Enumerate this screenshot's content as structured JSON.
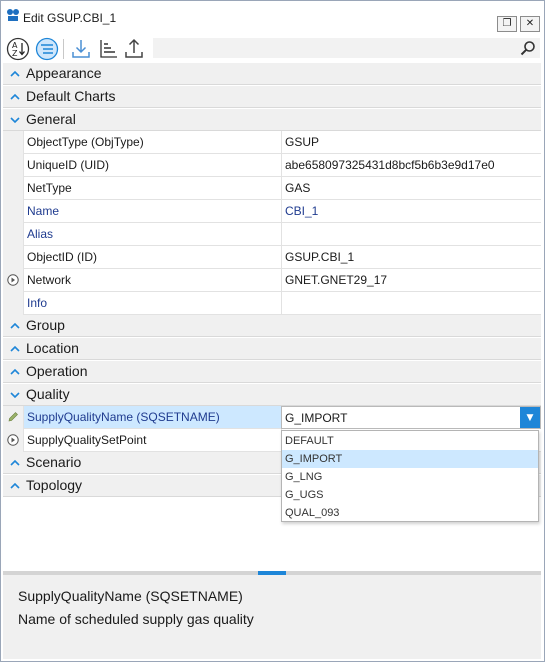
{
  "window": {
    "title": "Edit GSUP.CBI_1",
    "maximize_glyph": "❐",
    "close_glyph": "✕"
  },
  "toolbar": {
    "buttons": [
      {
        "icon": "sort-alphabetical-icon"
      },
      {
        "icon": "categorized-view-icon",
        "active": true
      },
      {
        "icon": "import-icon"
      },
      {
        "icon": "sort-list-icon"
      },
      {
        "icon": "export-icon"
      }
    ],
    "search": {
      "value": "",
      "placeholder": ""
    }
  },
  "categories": {
    "appearance": "Appearance",
    "default_charts": "Default Charts",
    "general": "General",
    "group": "Group",
    "location": "Location",
    "operation": "Operation",
    "quality": "Quality",
    "scenario": "Scenario",
    "topology": "Topology"
  },
  "general_props": [
    {
      "name": "ObjectType (ObjType)",
      "value": "GSUP"
    },
    {
      "name": "UniqueID (UID)",
      "value": "abe658097325431d8bcf5b6b3e9d17e0"
    },
    {
      "name": "NetType",
      "value": "GAS"
    },
    {
      "name": "Name",
      "value": "CBI_1"
    },
    {
      "name": "Alias",
      "value": ""
    },
    {
      "name": "ObjectID (ID)",
      "value": "GSUP.CBI_1"
    },
    {
      "name": "Network",
      "value": "GNET.GNET29_17"
    },
    {
      "name": "Info",
      "value": ""
    }
  ],
  "quality_props": [
    {
      "name": "SupplyQualityName (SQSETNAME)",
      "value": "G_IMPORT"
    },
    {
      "name": "SupplyQualitySetPoint",
      "value": ""
    }
  ],
  "dropdown": {
    "arrow_glyph": "▼",
    "options": [
      "DEFAULT",
      "G_IMPORT",
      "G_LNG",
      "G_UGS",
      "QUAL_093"
    ],
    "selected": "G_IMPORT"
  },
  "description": {
    "title": "SupplyQualityName (SQSETNAME)",
    "text": "Name of scheduled supply gas quality"
  },
  "colors": {
    "accent": "#1e86d8",
    "selection": "#cde8ff",
    "link_text": "#1f3b8f",
    "category_bg": "#f0f0f0"
  }
}
